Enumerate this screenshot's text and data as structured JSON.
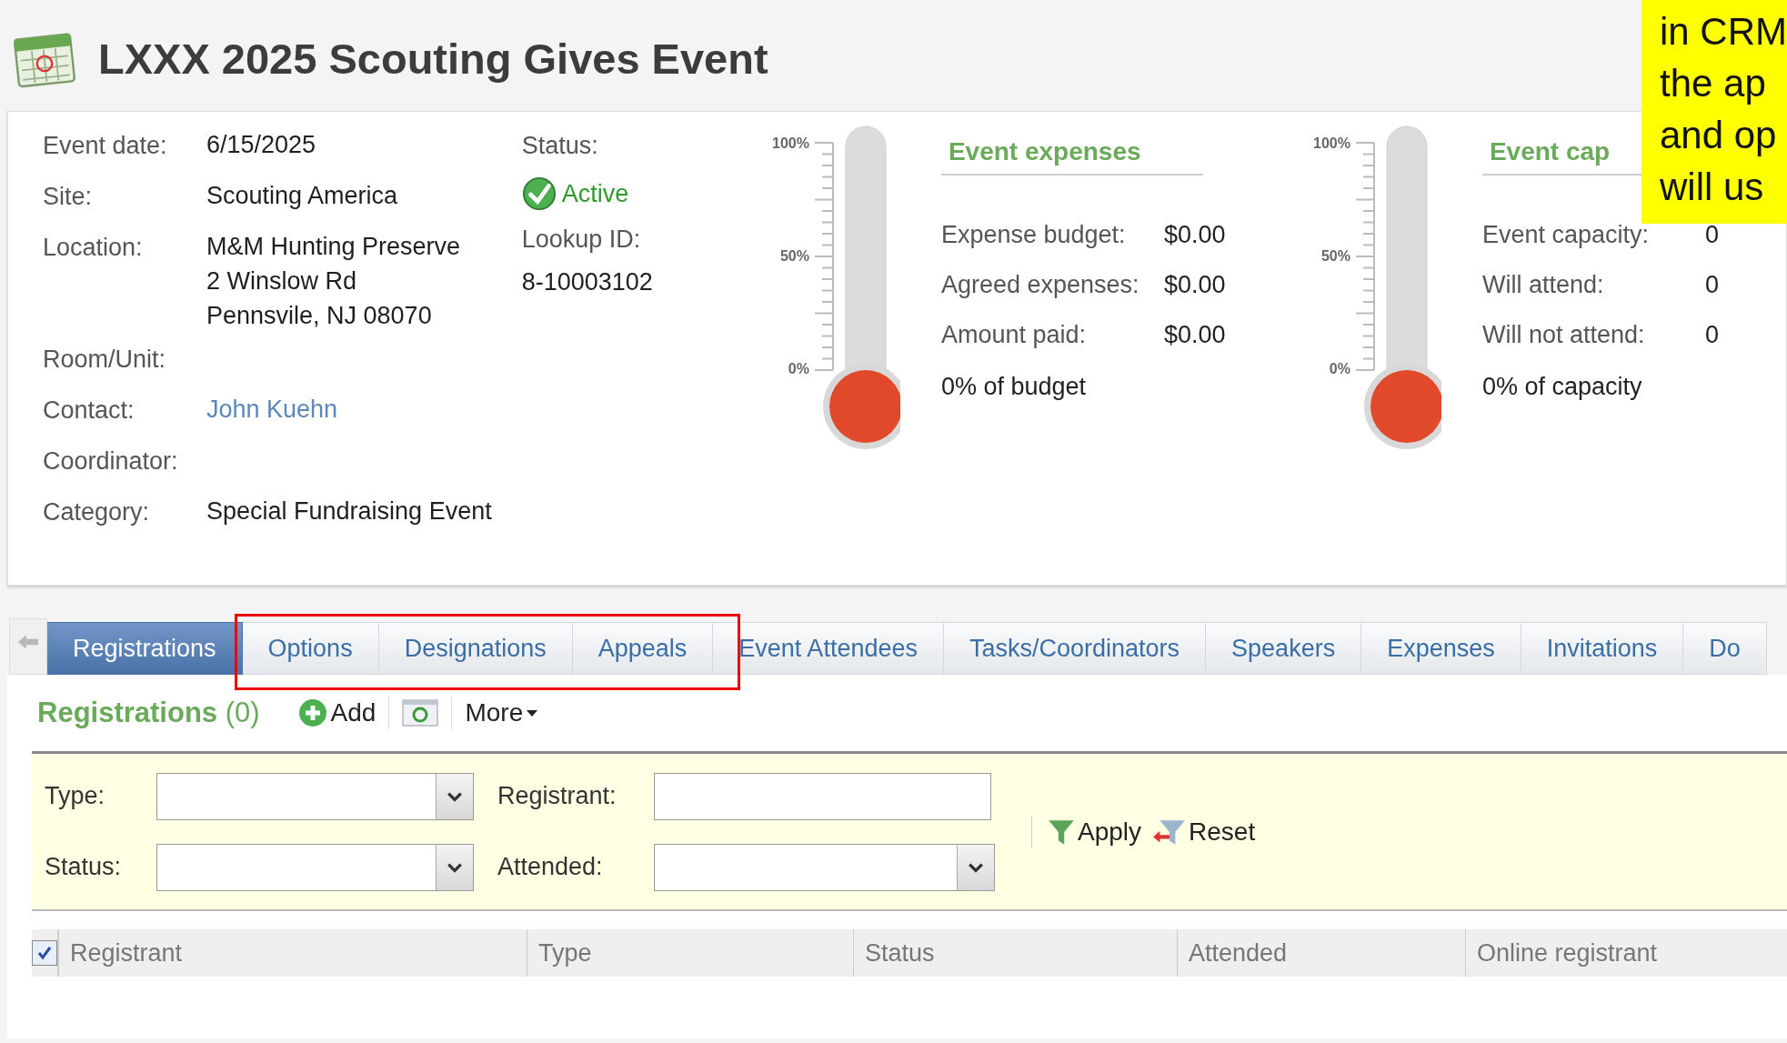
{
  "title": "LXXX 2025 Scouting Gives Event",
  "details": [
    {
      "label": "Event date:",
      "kind": "text",
      "lines": [
        "6/15/2025"
      ]
    },
    {
      "label": "Site:",
      "kind": "text",
      "lines": [
        "Scouting America"
      ]
    },
    {
      "label": "Location:",
      "kind": "text",
      "lines": [
        "M&M Hunting Preserve",
        "2 Winslow Rd",
        "Pennsvile, NJ  08070"
      ]
    },
    {
      "label": "Room/Unit:",
      "kind": "empty"
    },
    {
      "label": "Contact:",
      "kind": "link",
      "lines": [
        "John Kuehn"
      ]
    },
    {
      "label": "Coordinator:",
      "kind": "empty"
    },
    {
      "label": "Category:",
      "kind": "text",
      "lines": [
        "Special Fundraising Event"
      ]
    }
  ],
  "status": {
    "label": "Status:",
    "value": "Active",
    "lookup_label": "Lookup ID:",
    "lookup_id": "8-10003102"
  },
  "gauges": [
    {
      "scale": [
        "100%",
        "50%",
        "0%"
      ],
      "level": 0,
      "heading": "Event expenses",
      "rows": [
        {
          "label": "Expense budget:",
          "value": "$0.00"
        },
        {
          "label": "Agreed expenses:",
          "value": "$0.00"
        },
        {
          "label": "Amount paid:",
          "value": "$0.00"
        }
      ],
      "summary": "0% of budget"
    },
    {
      "scale": [
        "100%",
        "50%",
        "0%"
      ],
      "level": 0,
      "heading": "Event cap",
      "rows": [
        {
          "label": "Event capacity:",
          "value": "0"
        },
        {
          "label": "Will attend:",
          "value": "0"
        },
        {
          "label": "Will not attend:",
          "value": "0"
        }
      ],
      "summary": "0% of capacity"
    }
  ],
  "note": {
    "lines": [
      "in CRM",
      "the ap",
      "and op",
      "will us"
    ]
  },
  "tabs": [
    {
      "label": "Registrations",
      "selected": true
    },
    {
      "label": "Options",
      "selected": false
    },
    {
      "label": "Designations",
      "selected": false
    },
    {
      "label": "Appeals",
      "selected": false
    },
    {
      "label": "Event Attendees",
      "selected": false
    },
    {
      "label": "Tasks/Coordinators",
      "selected": false
    },
    {
      "label": "Speakers",
      "selected": false
    },
    {
      "label": "Expenses",
      "selected": false
    },
    {
      "label": "Invitations",
      "selected": false
    },
    {
      "label": "Do",
      "selected": false
    }
  ],
  "section": {
    "title": "Registrations",
    "count": "(0)",
    "add": "Add",
    "more": "More"
  },
  "filters": {
    "type_label": "Type:",
    "status_label": "Status:",
    "registrant_label": "Registrant:",
    "attended_label": "Attended:",
    "apply": "Apply",
    "reset": "Reset"
  },
  "grid": {
    "select_all_checked": true,
    "columns": [
      "Registrant",
      "Type",
      "Status",
      "Attended",
      "Online registrant"
    ]
  }
}
